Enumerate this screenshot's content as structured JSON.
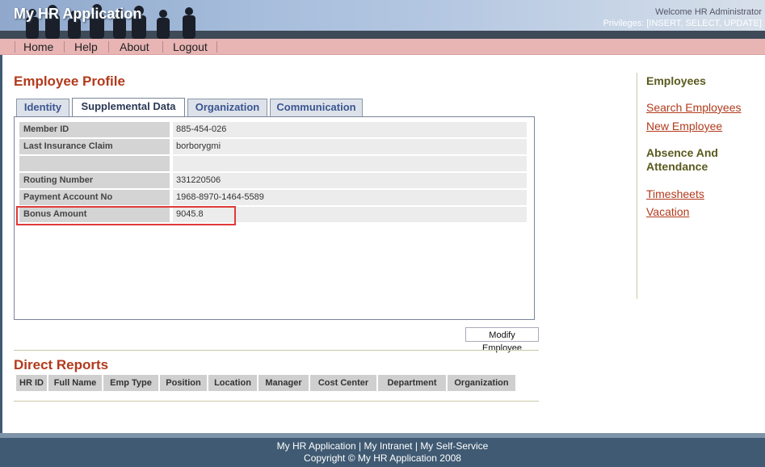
{
  "header": {
    "app_title": "My HR Application",
    "welcome": "Welcome HR Administrator",
    "privileges": "Privileges: [INSERT, SELECT, UPDATE]"
  },
  "nav": {
    "items": [
      {
        "label": "Home"
      },
      {
        "label": "Help"
      },
      {
        "label": "About"
      },
      {
        "label": "Logout"
      }
    ]
  },
  "main": {
    "title": "Employee Profile",
    "tabs": [
      {
        "label": "Identity",
        "active": false
      },
      {
        "label": "Supplemental Data",
        "active": true
      },
      {
        "label": "Organization",
        "active": false
      },
      {
        "label": "Communication",
        "active": false
      }
    ],
    "profile_rows": [
      {
        "label": "Member ID",
        "value": "885-454-026"
      },
      {
        "label": "Last Insurance Claim",
        "value": "borborygmi"
      },
      {
        "label": "",
        "value": ""
      },
      {
        "label": "Routing Number",
        "value": "331220506"
      },
      {
        "label": "Payment Account No",
        "value": "1968-8970-1464-5589"
      },
      {
        "label": "Bonus Amount",
        "value": "9045.8"
      }
    ],
    "modify_button": "Modify Employee",
    "direct_reports": {
      "title": "Direct Reports",
      "columns": [
        "HR ID",
        "Full Name",
        "Emp Type",
        "Position",
        "Location",
        "Manager",
        "Cost Center",
        "Department",
        "Organization"
      ]
    }
  },
  "sidebar": {
    "employees_heading": "Employees",
    "employee_links": [
      "Search Employees",
      "New Employee"
    ],
    "absence_heading_line1": "Absence And",
    "absence_heading_line2": "Attendance",
    "absence_links": [
      "Timesheets",
      "Vacation"
    ]
  },
  "footer": {
    "links": [
      "My HR Application",
      "My Intranet",
      "My Self-Service"
    ],
    "separator": " | ",
    "copyright": "Copyright © My HR Application 2008"
  },
  "colors": {
    "accent_red": "#b23a1c",
    "nav_pink": "#e8b4b4",
    "footer_blue": "#3f5a72",
    "highlight": "#e03a3a",
    "sidebar_heading_olive": "#5a5a1e"
  }
}
